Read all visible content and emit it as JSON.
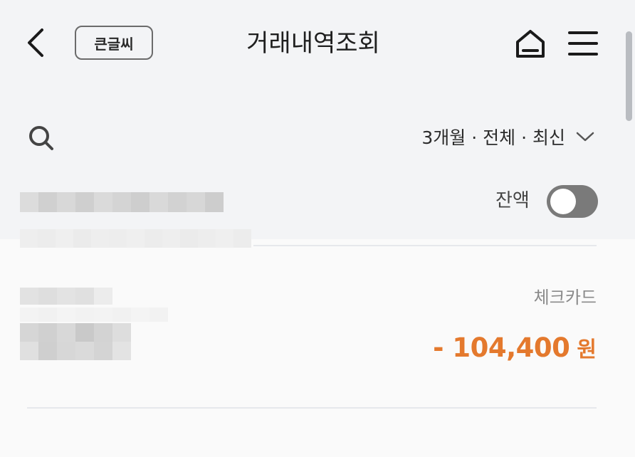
{
  "header": {
    "title": "거래내역조회",
    "big_text_label": "큰글씨"
  },
  "filter": {
    "summary": "3개월 · 전체 · 최신"
  },
  "account": {
    "balance_label": "잔액",
    "balance_toggle_on": false
  },
  "transactions": [
    {
      "type": "체크카드",
      "amount": "- 104,400",
      "unit": "원"
    }
  ],
  "colors": {
    "amount": "#e4792d",
    "toggle_off": "#7a7a7a",
    "text_primary": "#1f1f1f"
  },
  "icons": {
    "back": "chevron-left-icon",
    "home": "home-icon",
    "menu": "hamburger-menu-icon",
    "search": "search-icon",
    "filter_dropdown": "chevron-down-icon"
  }
}
